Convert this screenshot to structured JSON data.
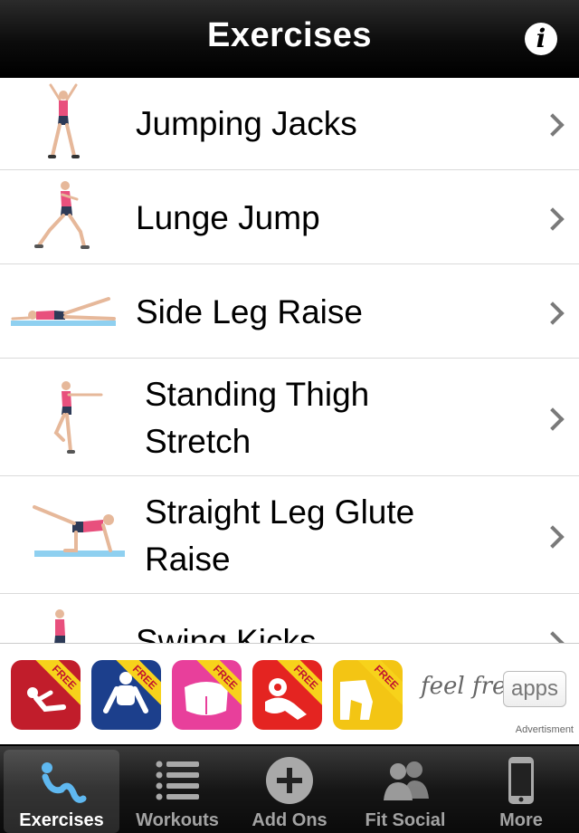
{
  "nav": {
    "title": "Exercises",
    "info_icon": "info-icon",
    "info_glyph": "i"
  },
  "exercises": [
    {
      "label": "Jumping Jacks",
      "icon": "jumping-jacks-figure"
    },
    {
      "label": "Lunge Jump",
      "icon": "lunge-jump-figure"
    },
    {
      "label": "Side Leg Raise",
      "icon": "side-leg-raise-figure"
    },
    {
      "label_line1": "Standing Thigh",
      "label_line2": "Stretch",
      "icon": "thigh-stretch-figure"
    },
    {
      "label_line1": "Straight Leg Glute",
      "label_line2": "Raise",
      "icon": "glute-raise-figure"
    },
    {
      "label": "Swing Kicks",
      "icon": "swing-kicks-figure"
    }
  ],
  "ad": {
    "ribbon": "FREE",
    "brand": "feel free",
    "brand_apps": "apps",
    "caption": "Advertisment",
    "tiles": [
      {
        "icon": "situps-app-icon",
        "bg": "#c11d2b"
      },
      {
        "icon": "pushups-app-icon",
        "bg": "#1c3f8c"
      },
      {
        "icon": "butt-app-icon",
        "bg": "#e83f9b"
      },
      {
        "icon": "dumbbell-app-icon",
        "bg": "#e42421"
      },
      {
        "icon": "legs-app-icon",
        "bg": "#f3c514"
      }
    ]
  },
  "tabs": [
    {
      "label": "Exercises",
      "icon": "exercises-tab-icon",
      "active": true
    },
    {
      "label": "Workouts",
      "icon": "list-icon",
      "active": false
    },
    {
      "label": "Add Ons",
      "icon": "plus-circle-icon",
      "active": false
    },
    {
      "label": "Fit Social",
      "icon": "people-icon",
      "active": false
    },
    {
      "label": "More",
      "icon": "phone-icon",
      "active": false
    }
  ],
  "colors": {
    "accent_blue": "#5fb8f0",
    "pink_top": "#e8507d"
  }
}
